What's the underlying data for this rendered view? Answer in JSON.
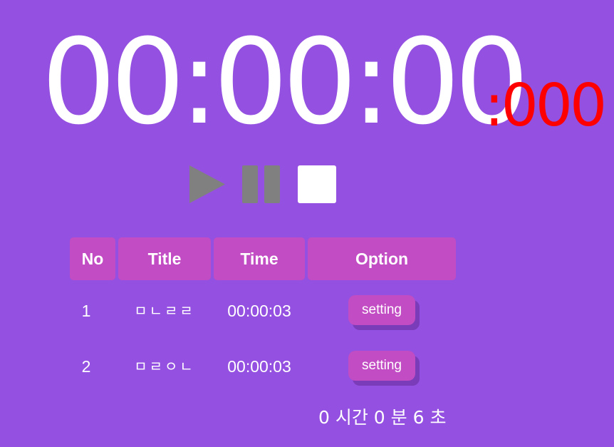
{
  "clock": {
    "main": "00:00:00",
    "ms": ":000",
    "ms_color": "#ff0000"
  },
  "controls": {
    "play_icon": "play-icon",
    "pause_icon": "pause-icon",
    "stop_icon": "stop-icon",
    "disabled_color": "#808080",
    "active_color": "#ffffff"
  },
  "table": {
    "headers": {
      "no": "No",
      "title": "Title",
      "time": "Time",
      "option": "Option"
    },
    "rows": [
      {
        "no": "1",
        "title": "ㅁㄴㄹㄹ",
        "time": "00:00:03",
        "option": "setting"
      },
      {
        "no": "2",
        "title": "ㅁㄹㅇㄴ",
        "time": "00:00:03",
        "option": "setting"
      }
    ]
  },
  "total": "0 시간 0 분 6 초",
  "colors": {
    "background": "#9450e0",
    "accent": "#c24cc3"
  }
}
